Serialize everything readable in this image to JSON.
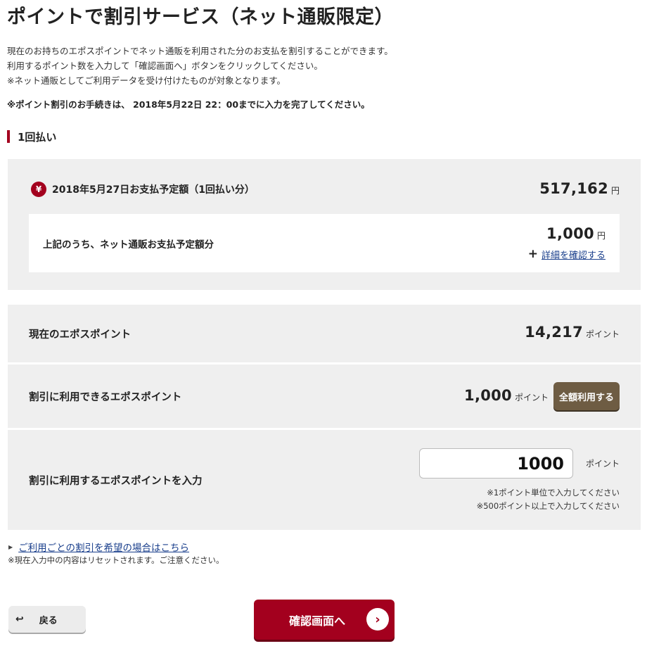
{
  "page": {
    "title": "ポイントで割引サービス（ネット通販限定）",
    "intro_line1": "現在のお持ちのエポスポイントでネット通販を利用された分のお支払を割引することができます。",
    "intro_line2": "利用するポイント数を入力して「確認画面へ」ボタンをクリックしてください。",
    "intro_line3": "※ネット通販としてご利用データを受け付けたものが対象となります。",
    "deadline_notice": "※ポイント割引のお手続きは、 2018年5月22日 22：00までに入力を完了してください。"
  },
  "section": {
    "label": "1回払い"
  },
  "payment": {
    "yen_symbol": "¥",
    "due_label": "2018年5月27日お支払予定額（1回払い分）",
    "due_amount": "517,162",
    "yen_unit": "円",
    "net_label": "上記のうち、ネット通販お支払予定額分",
    "net_amount": "1,000",
    "detail_link": "詳細を確認する"
  },
  "points": {
    "unit": "ポイント",
    "current_label": "現在のエポスポイント",
    "current_value": "14,217",
    "available_label": "割引に利用できるエポスポイント",
    "available_value": "1,000",
    "use_all_button": "全額利用する",
    "input_label": "割引に利用するエポスポイントを入力",
    "input_value": "1000",
    "hint1": "※1ポイント単位で入力してください",
    "hint2": "※500ポイント以上で入力してください"
  },
  "footer": {
    "per_use_link": "ご利用ごとの割引を希望の場合はこちら",
    "reset_note": "※現在入力中の内容はリセットされます。ご注意ください。",
    "back_button": "戻る",
    "confirm_button": "確認画面へ"
  },
  "colors": {
    "accent": "#a3001e",
    "brown_button": "#6e5c43",
    "link": "#1a3f8c",
    "panel_bg": "#efefef"
  }
}
